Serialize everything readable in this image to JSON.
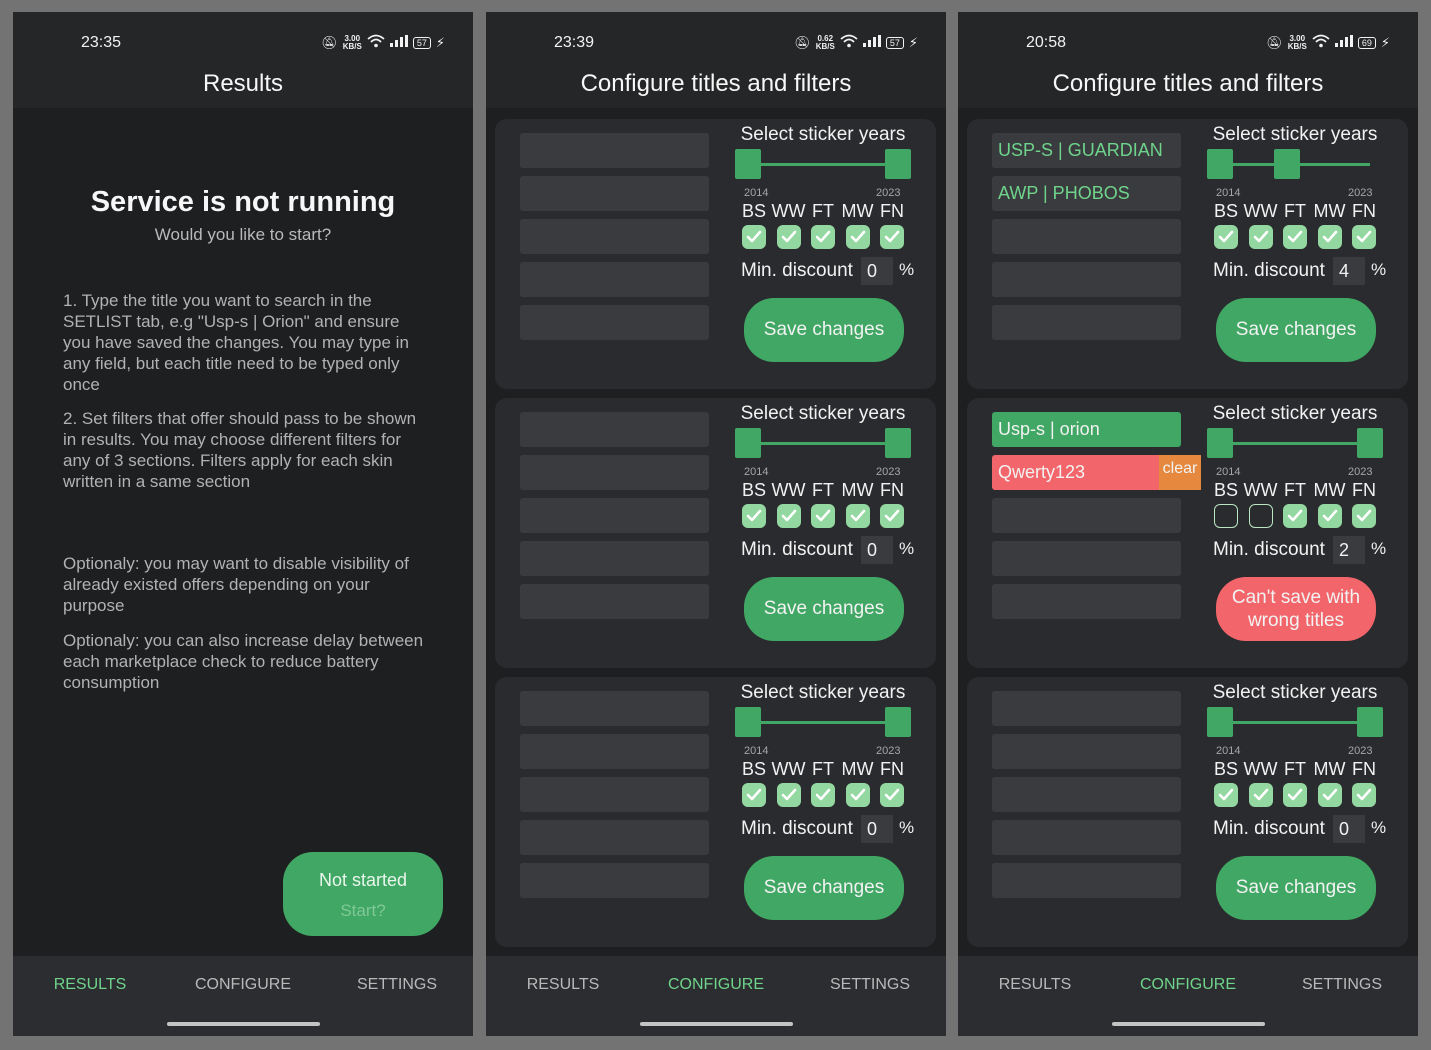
{
  "screens": [
    {
      "status": {
        "time": "23:35",
        "speed": "3.00",
        "speed_unit": "KB/S",
        "battery": "57"
      },
      "app_title": "Results",
      "heading": "Service is not running",
      "subheading": "Would you like to start?",
      "paragraphs": [
        "1. Type the title you want to search in the SETLIST tab, e.g \"Usp-s | Orion\" and ensure you have saved the changes. You may type in any field, but each title need to be typed only once",
        "2. Set filters that offer should pass to be shown in results. You may choose different filters for any of 3 sections. Filters apply for each skin written in a same section",
        "Optionaly: you may want to disable visibility of already existed offers depending on your purpose",
        "Optionaly: you can also increase delay between each marketplace check to reduce battery consumption"
      ],
      "start_button": {
        "line1": "Not started",
        "line2": "Start?"
      },
      "nav": [
        "RESULTS",
        "CONFIGURE",
        "SETTINGS"
      ]
    },
    {
      "status": {
        "time": "23:39",
        "speed": "0.62",
        "speed_unit": "KB/S",
        "battery": "57"
      },
      "app_title": "Configure titles and filters",
      "nav": [
        "RESULTS",
        "CONFIGURE",
        "SETTINGS"
      ],
      "cards": [
        {
          "titles": [
            "",
            "",
            "",
            "",
            ""
          ],
          "years_label": "Select sticker years",
          "year_min": "2014",
          "year_max": "2023",
          "range": [
            2014,
            2023
          ],
          "qualities": [
            "BS",
            "WW",
            "FT",
            "MW",
            "FN"
          ],
          "checked": [
            true,
            true,
            true,
            true,
            true
          ],
          "discount_label": "Min. discount",
          "discount": "0",
          "pct": "%",
          "save_label": "Save changes"
        },
        {
          "titles": [
            "",
            "",
            "",
            "",
            ""
          ],
          "years_label": "Select sticker years",
          "year_min": "2014",
          "year_max": "2023",
          "range": [
            2014,
            2023
          ],
          "qualities": [
            "BS",
            "WW",
            "FT",
            "MW",
            "FN"
          ],
          "checked": [
            true,
            true,
            true,
            true,
            true
          ],
          "discount_label": "Min. discount",
          "discount": "0",
          "pct": "%",
          "save_label": "Save changes"
        },
        {
          "titles": [
            "",
            "",
            "",
            "",
            ""
          ],
          "years_label": "Select sticker years",
          "year_min": "2014",
          "year_max": "2023",
          "range": [
            2014,
            2023
          ],
          "qualities": [
            "BS",
            "WW",
            "FT",
            "MW",
            "FN"
          ],
          "checked": [
            true,
            true,
            true,
            true,
            true
          ],
          "discount_label": "Min. discount",
          "discount": "0",
          "pct": "%",
          "save_label": "Save changes"
        }
      ]
    },
    {
      "status": {
        "time": "20:58",
        "speed": "3.00",
        "speed_unit": "KB/S",
        "battery": "69"
      },
      "app_title": "Configure titles and filters",
      "nav": [
        "RESULTS",
        "CONFIGURE",
        "SETTINGS"
      ],
      "cards": [
        {
          "titles": [
            "USP-S | GUARDIAN",
            "AWP | PHOBOS",
            "",
            "",
            ""
          ],
          "title_states": [
            "",
            "",
            "",
            "",
            ""
          ],
          "years_label": "Select sticker years",
          "year_min": "2014",
          "year_max": "2023",
          "range": [
            2014,
            2018
          ],
          "qualities": [
            "BS",
            "WW",
            "FT",
            "MW",
            "FN"
          ],
          "checked": [
            true,
            true,
            true,
            true,
            true
          ],
          "discount_label": "Min. discount",
          "discount": "4",
          "pct": "%",
          "save_label": "Save changes"
        },
        {
          "titles": [
            "Usp-s | orion",
            "Qwerty123",
            "",
            "",
            ""
          ],
          "title_states": [
            "good",
            "bad",
            "",
            "",
            ""
          ],
          "clear_label": "clear",
          "years_label": "Select sticker years",
          "year_min": "2014",
          "year_max": "2023",
          "range": [
            2014,
            2023
          ],
          "qualities": [
            "BS",
            "WW",
            "FT",
            "MW",
            "FN"
          ],
          "checked": [
            false,
            false,
            true,
            true,
            true
          ],
          "discount_label": "Min. discount",
          "discount": "2",
          "pct": "%",
          "save_label": "Can't save with wrong titles",
          "save_error": true
        },
        {
          "titles": [
            "",
            "",
            "",
            "",
            ""
          ],
          "title_states": [
            "",
            "",
            "",
            "",
            ""
          ],
          "years_label": "Select sticker years",
          "year_min": "2014",
          "year_max": "2023",
          "range": [
            2014,
            2023
          ],
          "qualities": [
            "BS",
            "WW",
            "FT",
            "MW",
            "FN"
          ],
          "checked": [
            true,
            true,
            true,
            true,
            true
          ],
          "discount_label": "Min. discount",
          "discount": "0",
          "pct": "%",
          "save_label": "Save changes"
        }
      ]
    }
  ],
  "active_tabs": [
    0,
    1,
    1
  ],
  "colors": {
    "accent": "#41a764",
    "accent_text": "#6fd48b",
    "error": "#f2666b",
    "clear": "#e6893f",
    "checkbox": "#93d8a0"
  }
}
